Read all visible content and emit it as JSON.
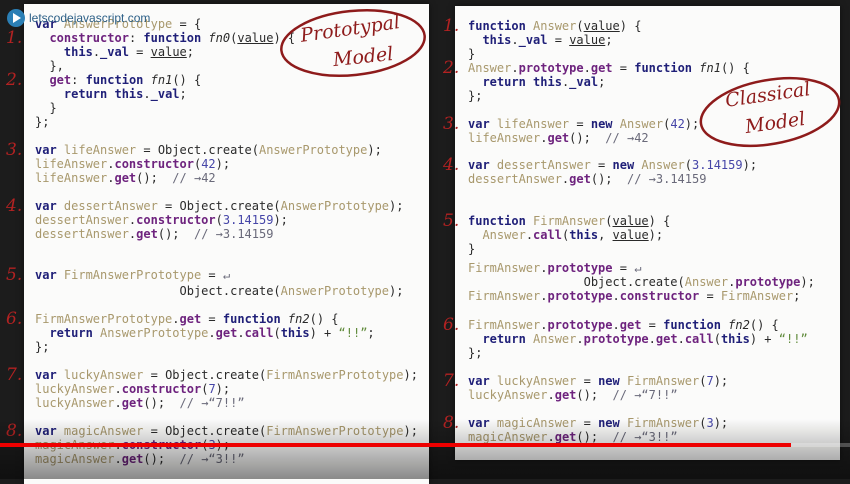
{
  "logo": {
    "text": "letscodejavascript.com"
  },
  "stamps": {
    "prototypal": {
      "line1": "Prototypal",
      "line2": "Model"
    },
    "classical": {
      "line1": "Classical",
      "line2": "Model"
    }
  },
  "left": [
    {
      "n": "",
      "tk": [
        [
          "k",
          "var "
        ],
        [
          "i",
          "AnswerPrototype"
        ],
        [
          "t",
          " = {"
        ]
      ]
    },
    {
      "n": "1.",
      "tk": [
        [
          "t",
          "  "
        ],
        [
          "p",
          "constructor"
        ],
        [
          "t",
          ": "
        ],
        [
          "k",
          "function "
        ],
        [
          "f",
          "fn0"
        ],
        [
          "t",
          "("
        ],
        [
          "u",
          "value"
        ],
        [
          "t",
          ") {"
        ]
      ]
    },
    {
      "n": "",
      "tk": [
        [
          "t",
          "    "
        ],
        [
          "k",
          "this"
        ],
        [
          "t",
          "."
        ],
        [
          "k",
          "_val"
        ],
        [
          "t",
          " = "
        ],
        [
          "u",
          "value"
        ],
        [
          "t",
          ";"
        ]
      ]
    },
    {
      "n": "",
      "tk": [
        [
          "t",
          "  },"
        ]
      ]
    },
    {
      "n": "2.",
      "tk": [
        [
          "t",
          "  "
        ],
        [
          "p",
          "get"
        ],
        [
          "t",
          ": "
        ],
        [
          "k",
          "function "
        ],
        [
          "f",
          "fn1"
        ],
        [
          "t",
          "() {"
        ]
      ]
    },
    {
      "n": "",
      "tk": [
        [
          "t",
          "    "
        ],
        [
          "k",
          "return this"
        ],
        [
          "t",
          "."
        ],
        [
          "k",
          "_val"
        ],
        [
          "t",
          ";"
        ]
      ]
    },
    {
      "n": "",
      "tk": [
        [
          "t",
          "  }"
        ]
      ]
    },
    {
      "n": "",
      "tk": [
        [
          "t",
          "};"
        ]
      ]
    },
    {
      "n": "3.",
      "tk": [
        [
          "k",
          "var "
        ],
        [
          "i",
          "lifeAnswer"
        ],
        [
          "t",
          " = Object.create("
        ],
        [
          "i",
          "AnswerPrototype"
        ],
        [
          "t",
          ");"
        ]
      ]
    },
    {
      "n": "",
      "tk": [
        [
          "i",
          "lifeAnswer"
        ],
        [
          "t",
          "."
        ],
        [
          "p",
          "constructor"
        ],
        [
          "t",
          "("
        ],
        [
          "n",
          "42"
        ],
        [
          "t",
          ");"
        ]
      ]
    },
    {
      "n": "",
      "tk": [
        [
          "i",
          "lifeAnswer"
        ],
        [
          "t",
          "."
        ],
        [
          "p",
          "get"
        ],
        [
          "t",
          "();  "
        ],
        [
          "c",
          "// →42"
        ]
      ]
    },
    {
      "n": "4.",
      "tk": [
        [
          "k",
          "var "
        ],
        [
          "i",
          "dessertAnswer"
        ],
        [
          "t",
          " = Object.create("
        ],
        [
          "i",
          "AnswerPrototype"
        ],
        [
          "t",
          ");"
        ]
      ]
    },
    {
      "n": "",
      "tk": [
        [
          "i",
          "dessertAnswer"
        ],
        [
          "t",
          "."
        ],
        [
          "p",
          "constructor"
        ],
        [
          "t",
          "("
        ],
        [
          "n",
          "3.14159"
        ],
        [
          "t",
          ");"
        ]
      ]
    },
    {
      "n": "",
      "tk": [
        [
          "i",
          "dessertAnswer"
        ],
        [
          "t",
          "."
        ],
        [
          "p",
          "get"
        ],
        [
          "t",
          "();  "
        ],
        [
          "c",
          "// →3.14159"
        ]
      ]
    },
    {
      "n": "5.",
      "tk": [
        [
          "k",
          "var "
        ],
        [
          "i",
          "FirmAnswerPrototype"
        ],
        [
          "t",
          " = "
        ],
        [
          "c",
          "↵"
        ]
      ]
    },
    {
      "n": "",
      "tk": [
        [
          "t",
          "                    Object.create("
        ],
        [
          "i",
          "AnswerPrototype"
        ],
        [
          "t",
          ");"
        ]
      ]
    },
    {
      "n": "6.",
      "tk": [
        [
          "i",
          "FirmAnswerPrototype"
        ],
        [
          "t",
          "."
        ],
        [
          "p",
          "get"
        ],
        [
          "t",
          " = "
        ],
        [
          "k",
          "function "
        ],
        [
          "f",
          "fn2"
        ],
        [
          "t",
          "() {"
        ]
      ]
    },
    {
      "n": "",
      "tk": [
        [
          "t",
          "  "
        ],
        [
          "k",
          "return "
        ],
        [
          "i",
          "AnswerPrototype"
        ],
        [
          "t",
          "."
        ],
        [
          "p",
          "get"
        ],
        [
          "t",
          "."
        ],
        [
          "p",
          "call"
        ],
        [
          "t",
          "("
        ],
        [
          "k",
          "this"
        ],
        [
          "t",
          ") + "
        ],
        [
          "s",
          "“!!”"
        ],
        [
          "t",
          ";"
        ]
      ]
    },
    {
      "n": "",
      "tk": [
        [
          "t",
          "};"
        ]
      ]
    },
    {
      "n": "7.",
      "tk": [
        [
          "k",
          "var "
        ],
        [
          "i",
          "luckyAnswer"
        ],
        [
          "t",
          " = Object.create("
        ],
        [
          "i",
          "FirmAnswerPrototype"
        ],
        [
          "t",
          ");"
        ]
      ]
    },
    {
      "n": "",
      "tk": [
        [
          "i",
          "luckyAnswer"
        ],
        [
          "t",
          "."
        ],
        [
          "p",
          "constructor"
        ],
        [
          "t",
          "("
        ],
        [
          "n",
          "7"
        ],
        [
          "t",
          ");"
        ]
      ]
    },
    {
      "n": "",
      "tk": [
        [
          "i",
          "luckyAnswer"
        ],
        [
          "t",
          "."
        ],
        [
          "p",
          "get"
        ],
        [
          "t",
          "();  "
        ],
        [
          "c",
          "// →“7!!”"
        ]
      ]
    },
    {
      "n": "8.",
      "tk": [
        [
          "k",
          "var "
        ],
        [
          "i",
          "magicAnswer"
        ],
        [
          "t",
          " = Object.create("
        ],
        [
          "i",
          "FirmAnswerPrototype"
        ],
        [
          "t",
          ");"
        ]
      ]
    },
    {
      "n": "",
      "tk": [
        [
          "i",
          "magicAnswer"
        ],
        [
          "t",
          "."
        ],
        [
          "p",
          "constructor"
        ],
        [
          "t",
          "("
        ],
        [
          "n",
          "3"
        ],
        [
          "t",
          ");"
        ]
      ]
    },
    {
      "n": "",
      "tk": [
        [
          "i",
          "magicAnswer"
        ],
        [
          "t",
          "."
        ],
        [
          "p",
          "get"
        ],
        [
          "t",
          "();  "
        ],
        [
          "c",
          "// →“3!!”"
        ]
      ]
    }
  ],
  "right": [
    {
      "n": "1.",
      "tk": [
        [
          "k",
          "function "
        ],
        [
          "i",
          "Answer"
        ],
        [
          "t",
          "("
        ],
        [
          "u",
          "value"
        ],
        [
          "t",
          ") {"
        ]
      ]
    },
    {
      "n": "",
      "tk": [
        [
          "t",
          "  "
        ],
        [
          "k",
          "this"
        ],
        [
          "t",
          "."
        ],
        [
          "k",
          "_val"
        ],
        [
          "t",
          " = "
        ],
        [
          "u",
          "value"
        ],
        [
          "t",
          ";"
        ]
      ]
    },
    {
      "n": "",
      "tk": [
        [
          "t",
          "}"
        ]
      ]
    },
    {
      "n": "2.",
      "tk": [
        [
          "i",
          "Answer"
        ],
        [
          "t",
          "."
        ],
        [
          "p",
          "prototype"
        ],
        [
          "t",
          "."
        ],
        [
          "p",
          "get"
        ],
        [
          "t",
          " = "
        ],
        [
          "k",
          "function "
        ],
        [
          "f",
          "fn1"
        ],
        [
          "t",
          "() {"
        ]
      ]
    },
    {
      "n": "",
      "tk": [
        [
          "t",
          "  "
        ],
        [
          "k",
          "return this"
        ],
        [
          "t",
          "."
        ],
        [
          "k",
          "_val"
        ],
        [
          "t",
          ";"
        ]
      ]
    },
    {
      "n": "",
      "tk": [
        [
          "t",
          "};"
        ]
      ]
    },
    {
      "n": "3.",
      "tk": [
        [
          "k",
          "var "
        ],
        [
          "i",
          "lifeAnswer"
        ],
        [
          "t",
          " = "
        ],
        [
          "k",
          "new "
        ],
        [
          "i",
          "Answer"
        ],
        [
          "t",
          "("
        ],
        [
          "n",
          "42"
        ],
        [
          "t",
          ");"
        ]
      ]
    },
    {
      "n": "",
      "tk": [
        [
          "i",
          "lifeAnswer"
        ],
        [
          "t",
          "."
        ],
        [
          "p",
          "get"
        ],
        [
          "t",
          "();  "
        ],
        [
          "c",
          "// →42"
        ]
      ]
    },
    {
      "n": "4.",
      "tk": [
        [
          "k",
          "var "
        ],
        [
          "i",
          "dessertAnswer"
        ],
        [
          "t",
          " = "
        ],
        [
          "k",
          "new "
        ],
        [
          "i",
          "Answer"
        ],
        [
          "t",
          "("
        ],
        [
          "n",
          "3.14159"
        ],
        [
          "t",
          ");"
        ]
      ]
    },
    {
      "n": "",
      "tk": [
        [
          "i",
          "dessertAnswer"
        ],
        [
          "t",
          "."
        ],
        [
          "p",
          "get"
        ],
        [
          "t",
          "();  "
        ],
        [
          "c",
          "// →3.14159"
        ]
      ]
    },
    {
      "n": "5.",
      "tk": [
        [
          "k",
          "function "
        ],
        [
          "i",
          "FirmAnswer"
        ],
        [
          "t",
          "("
        ],
        [
          "u",
          "value"
        ],
        [
          "t",
          ") {"
        ]
      ]
    },
    {
      "n": "",
      "tk": [
        [
          "t",
          "  "
        ],
        [
          "i",
          "Answer"
        ],
        [
          "t",
          "."
        ],
        [
          "p",
          "call"
        ],
        [
          "t",
          "("
        ],
        [
          "k",
          "this"
        ],
        [
          "t",
          ", "
        ],
        [
          "u",
          "value"
        ],
        [
          "t",
          ");"
        ]
      ]
    },
    {
      "n": "",
      "tk": [
        [
          "t",
          "}"
        ]
      ]
    },
    {
      "n": "",
      "tk": [
        [
          "i",
          "FirmAnswer"
        ],
        [
          "t",
          "."
        ],
        [
          "p",
          "prototype"
        ],
        [
          "t",
          " = "
        ],
        [
          "c",
          "↵"
        ]
      ]
    },
    {
      "n": "",
      "tk": [
        [
          "t",
          "                Object.create("
        ],
        [
          "i",
          "Answer"
        ],
        [
          "t",
          "."
        ],
        [
          "p",
          "prototype"
        ],
        [
          "t",
          ");"
        ]
      ]
    },
    {
      "n": "",
      "tk": [
        [
          "i",
          "FirmAnswer"
        ],
        [
          "t",
          "."
        ],
        [
          "p",
          "prototype"
        ],
        [
          "t",
          "."
        ],
        [
          "p",
          "constructor"
        ],
        [
          "t",
          " = "
        ],
        [
          "i",
          "FirmAnswer"
        ],
        [
          "t",
          ";"
        ]
      ]
    },
    {
      "n": "6.",
      "tk": [
        [
          "i",
          "FirmAnswer"
        ],
        [
          "t",
          "."
        ],
        [
          "p",
          "prototype"
        ],
        [
          "t",
          "."
        ],
        [
          "p",
          "get"
        ],
        [
          "t",
          " = "
        ],
        [
          "k",
          "function "
        ],
        [
          "f",
          "fn2"
        ],
        [
          "t",
          "() {"
        ]
      ]
    },
    {
      "n": "",
      "tk": [
        [
          "t",
          "  "
        ],
        [
          "k",
          "return "
        ],
        [
          "i",
          "Answer"
        ],
        [
          "t",
          "."
        ],
        [
          "p",
          "prototype"
        ],
        [
          "t",
          "."
        ],
        [
          "p",
          "get"
        ],
        [
          "t",
          "."
        ],
        [
          "p",
          "call"
        ],
        [
          "t",
          "("
        ],
        [
          "k",
          "this"
        ],
        [
          "t",
          ") + "
        ],
        [
          "s",
          "“!!”"
        ]
      ]
    },
    {
      "n": "",
      "tk": [
        [
          "t",
          "};"
        ]
      ]
    },
    {
      "n": "7.",
      "tk": [
        [
          "k",
          "var "
        ],
        [
          "i",
          "luckyAnswer"
        ],
        [
          "t",
          " = "
        ],
        [
          "k",
          "new "
        ],
        [
          "i",
          "FirmAnswer"
        ],
        [
          "t",
          "("
        ],
        [
          "n",
          "7"
        ],
        [
          "t",
          ");"
        ]
      ]
    },
    {
      "n": "",
      "tk": [
        [
          "i",
          "luckyAnswer"
        ],
        [
          "t",
          "."
        ],
        [
          "p",
          "get"
        ],
        [
          "t",
          "();  "
        ],
        [
          "c",
          "// →“7!!”"
        ]
      ]
    },
    {
      "n": "8.",
      "tk": [
        [
          "k",
          "var "
        ],
        [
          "i",
          "magicAnswer"
        ],
        [
          "t",
          " = "
        ],
        [
          "k",
          "new "
        ],
        [
          "i",
          "FirmAnswer"
        ],
        [
          "t",
          "("
        ],
        [
          "n",
          "3"
        ],
        [
          "t",
          ");"
        ]
      ]
    },
    {
      "n": "",
      "tk": [
        [
          "i",
          "magicAnswer"
        ],
        [
          "t",
          "."
        ],
        [
          "p",
          "get"
        ],
        [
          "t",
          "();  "
        ],
        [
          "c",
          "// →“3!!”"
        ]
      ]
    }
  ],
  "video": {
    "progress_percent": 93,
    "accent": "#ee0000"
  }
}
